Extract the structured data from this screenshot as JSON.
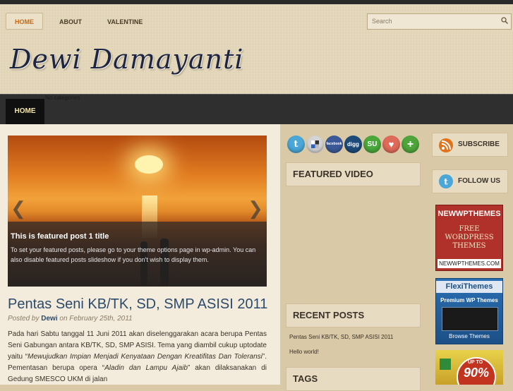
{
  "topnav": {
    "items": [
      "HOME",
      "ABOUT",
      "VALENTINE"
    ]
  },
  "search": {
    "placeholder": "Search"
  },
  "site": {
    "title": "Dewi Damayanti"
  },
  "catnav": {
    "home": "HOME",
    "no_categories": "No categories"
  },
  "slider": {
    "title": "This is featured post 1 title",
    "text": "To set your featured posts, please go to your theme options page in wp-admin. You can also disable featured posts slideshow if you don't wish to display them."
  },
  "post": {
    "title": "Pentas Seni KB/TK, SD, SMP ASISI 2011",
    "meta_prefix": "Posted by",
    "author": "Dewi",
    "meta_on": "on February 25th, 2011",
    "body_1": "Pada hari Sabtu tanggal 11 Juni 2011 akan diselenggarakan acara berupa  Pentas Seni Gabungan antara KB/TK, SD, SMP ASISI.   Tema yang diambil cukup uptodate yaitu “",
    "body_em1": "Mewujudkan Impian Menjadi Kenyataan Dengan Kreatifitas Dan Toleransi",
    "body_2": "”.  Pementasan berupa opera “",
    "body_em2": "Aladin dan Lampu Ajaib",
    "body_3": "” akan dilaksanakan di Gedung SMESCO UKM di jalan"
  },
  "social": {
    "icons": [
      "twitter-icon",
      "delicious-icon",
      "facebook-icon",
      "digg-icon",
      "stumbleupon-icon",
      "favorite-icon",
      "add-icon"
    ],
    "labels": {
      "twitter": "t",
      "facebook": "facebook",
      "digg": "digg",
      "stumble": "SU",
      "add": "+"
    }
  },
  "widgets": {
    "featured_video": "FEATURED VIDEO",
    "recent_posts": "RECENT POSTS",
    "recent_items": [
      "Pentas Seni KB/TK, SD, SMP ASISI 2011",
      "Hello world!"
    ],
    "tags": "TAGS"
  },
  "right": {
    "subscribe": "SUBSCRIBE",
    "follow": "FOLLOW US",
    "ad1": {
      "brand": "NEWWPTHEMES",
      "line1": "FREE",
      "line2": "WORDPRESS",
      "line3": "THEMES",
      "url": "NEWWPTHEMES.COM"
    },
    "ad2": {
      "brand": "FlexiThemes",
      "line": "Premium WP Themes",
      "cta": "Browse Themes"
    },
    "ad3": {
      "up_to": "UP TO",
      "percent": "90%"
    }
  },
  "colors": {
    "accent_orange": "#c46a1a",
    "title_blue": "#2c4a6b",
    "dark_bar": "#2f2f2f"
  }
}
